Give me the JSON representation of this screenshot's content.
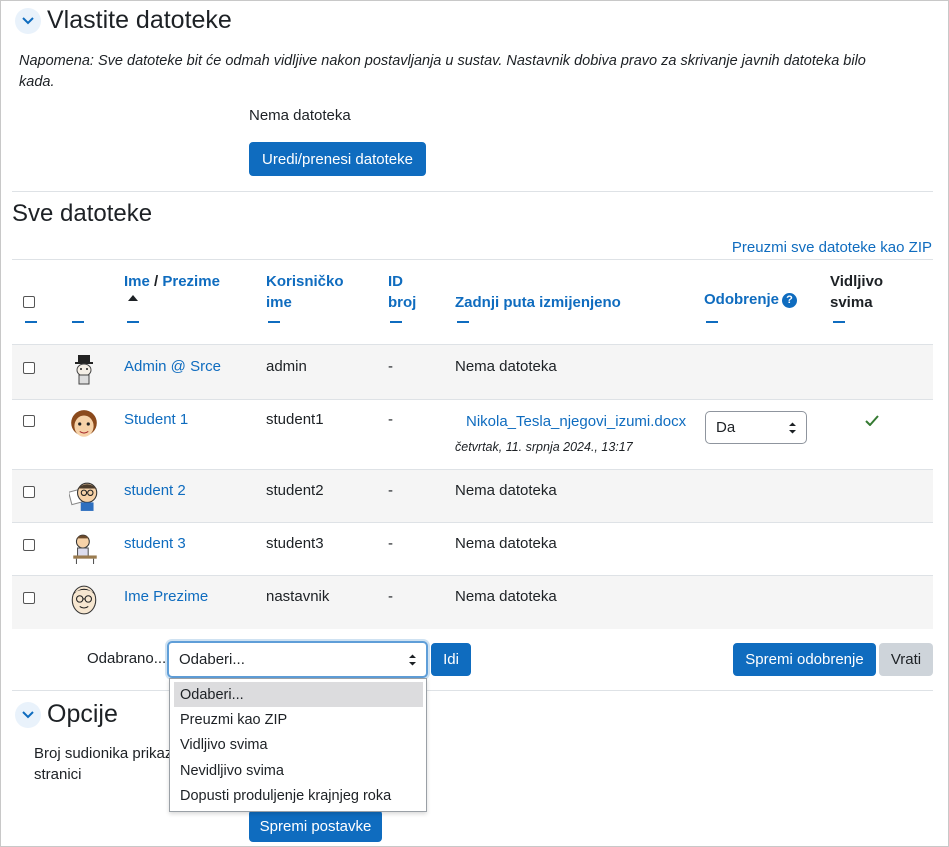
{
  "own_files": {
    "title": "Vlastite datoteke",
    "note": "Napomena: Sve datoteke bit će odmah vidljive nakon postavljanja u sustav. Nastavnik dobiva pravo za skrivanje javnih datoteka bilo kada.",
    "empty_text": "Nema datoteka",
    "edit_button": "Uredi/prenesi datoteke"
  },
  "all_files": {
    "title": "Sve datoteke",
    "download_zip_link": "Preuzmi sve datoteke kao ZIP",
    "headers": {
      "first_name": "Ime",
      "separator": " / ",
      "last_name": "Prezime",
      "username": "Korisničko ime",
      "id_number": "ID broj",
      "last_modified": "Zadnji puta izmijenjeno",
      "approval": "Odobrenje",
      "visible_to_all": "Vidljivo svima"
    },
    "rows": [
      {
        "name": "Admin @ Srce",
        "username": "admin",
        "id": "-",
        "modified": "Nema datoteka",
        "file": "",
        "date": "",
        "approval": "",
        "visible": "",
        "avatar": "admin-avatar"
      },
      {
        "name": "Student 1",
        "username": "student1",
        "id": "-",
        "modified": "",
        "file": "Nikola_Tesla_njegovi_izumi.docx",
        "date": "četvrtak, 11. srpnja 2024., 13:17",
        "approval": "Da",
        "visible": "✓",
        "avatar": "student-avatar"
      },
      {
        "name": "student 2",
        "username": "student2",
        "id": "-",
        "modified": "Nema datoteka",
        "file": "",
        "date": "",
        "approval": "",
        "visible": "",
        "avatar": "student-avatar"
      },
      {
        "name": "student 3",
        "username": "student3",
        "id": "-",
        "modified": "Nema datoteka",
        "file": "",
        "date": "",
        "approval": "",
        "visible": "",
        "avatar": "student-avatar"
      },
      {
        "name": "Ime Prezime",
        "username": "nastavnik",
        "id": "-",
        "modified": "Nema datoteka",
        "file": "",
        "date": "",
        "approval": "",
        "visible": "",
        "avatar": "teacher-avatar"
      }
    ],
    "bulk": {
      "label": "Odabrano...",
      "select_value": "Odaberi...",
      "go_button": "Idi",
      "options": [
        "Odaberi...",
        "Preuzmi kao ZIP",
        "Vidljivo svima",
        "Nevidljivo svima",
        "Dopusti produljenje krajnjeg roka"
      ]
    },
    "save_approval_button": "Spremi odobrenje",
    "revert_button": "Vrati"
  },
  "options": {
    "title": "Opcije",
    "participants_label_1": "Broj sudionika prikaz",
    "participants_label_2": "stranici",
    "save_settings_button": "Spremi postavke"
  },
  "colors": {
    "accent": "#0f6cbf",
    "check": "#357a32"
  }
}
